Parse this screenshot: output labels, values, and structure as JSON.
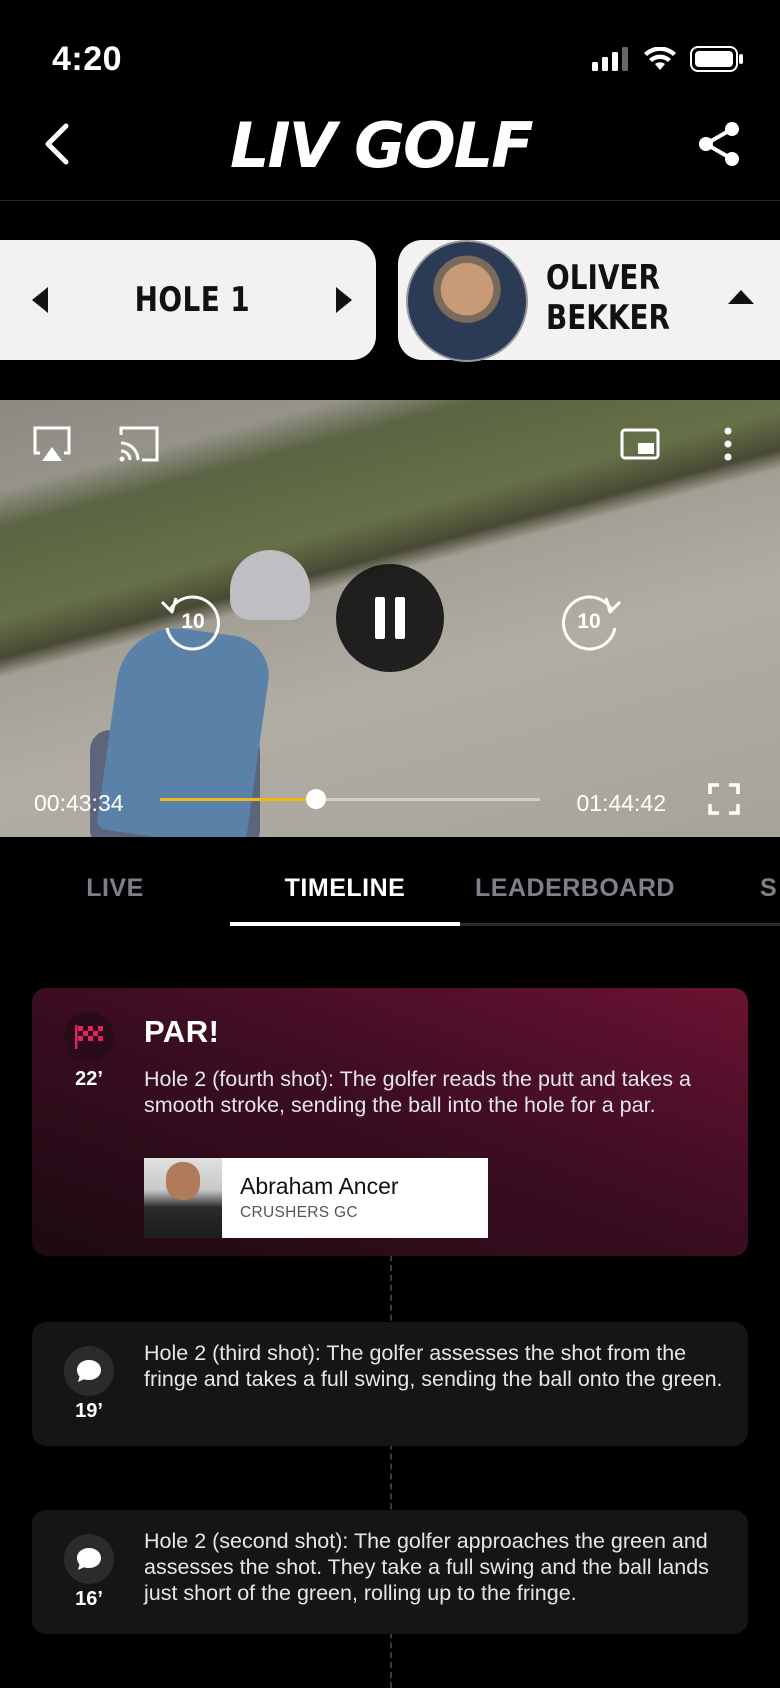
{
  "status_bar": {
    "time": "4:20"
  },
  "header": {
    "logo_text": "LIV GOLF"
  },
  "hole_selector": {
    "label": "HOLE 1"
  },
  "player": {
    "first_name": "OLIVER",
    "last_name": "BEKKER"
  },
  "video": {
    "current_time": "00:43:34",
    "duration": "01:44:42",
    "progress_fraction": 0.41,
    "skip_back_label": "10",
    "skip_forward_label": "10",
    "accent_color": "#f5b417"
  },
  "tabs": [
    {
      "label": "LIVE"
    },
    {
      "label": "TIMELINE"
    },
    {
      "label": "LEADERBOARD"
    },
    {
      "label": "S"
    }
  ],
  "timeline": [
    {
      "title": "PAR!",
      "time": "22’",
      "icon": "checkered-flag-icon",
      "text": "Hole 2 (fourth shot): The golfer reads the putt and takes a smooth stroke, sending the ball into the hole for a par.",
      "player_name": "Abraham Ancer",
      "player_team": "CRUSHERS GC"
    },
    {
      "time": "19’",
      "icon": "comment-icon",
      "text": "Hole 2 (third shot): The golfer assesses the shot from the fringe and takes a full swing, sending the ball onto the green."
    },
    {
      "time": "16’",
      "icon": "comment-icon",
      "text": "Hole 2 (second shot): The golfer approaches the green and assesses the shot. They take a full swing and the ball lands just short of the green, rolling up to the fringe."
    }
  ]
}
